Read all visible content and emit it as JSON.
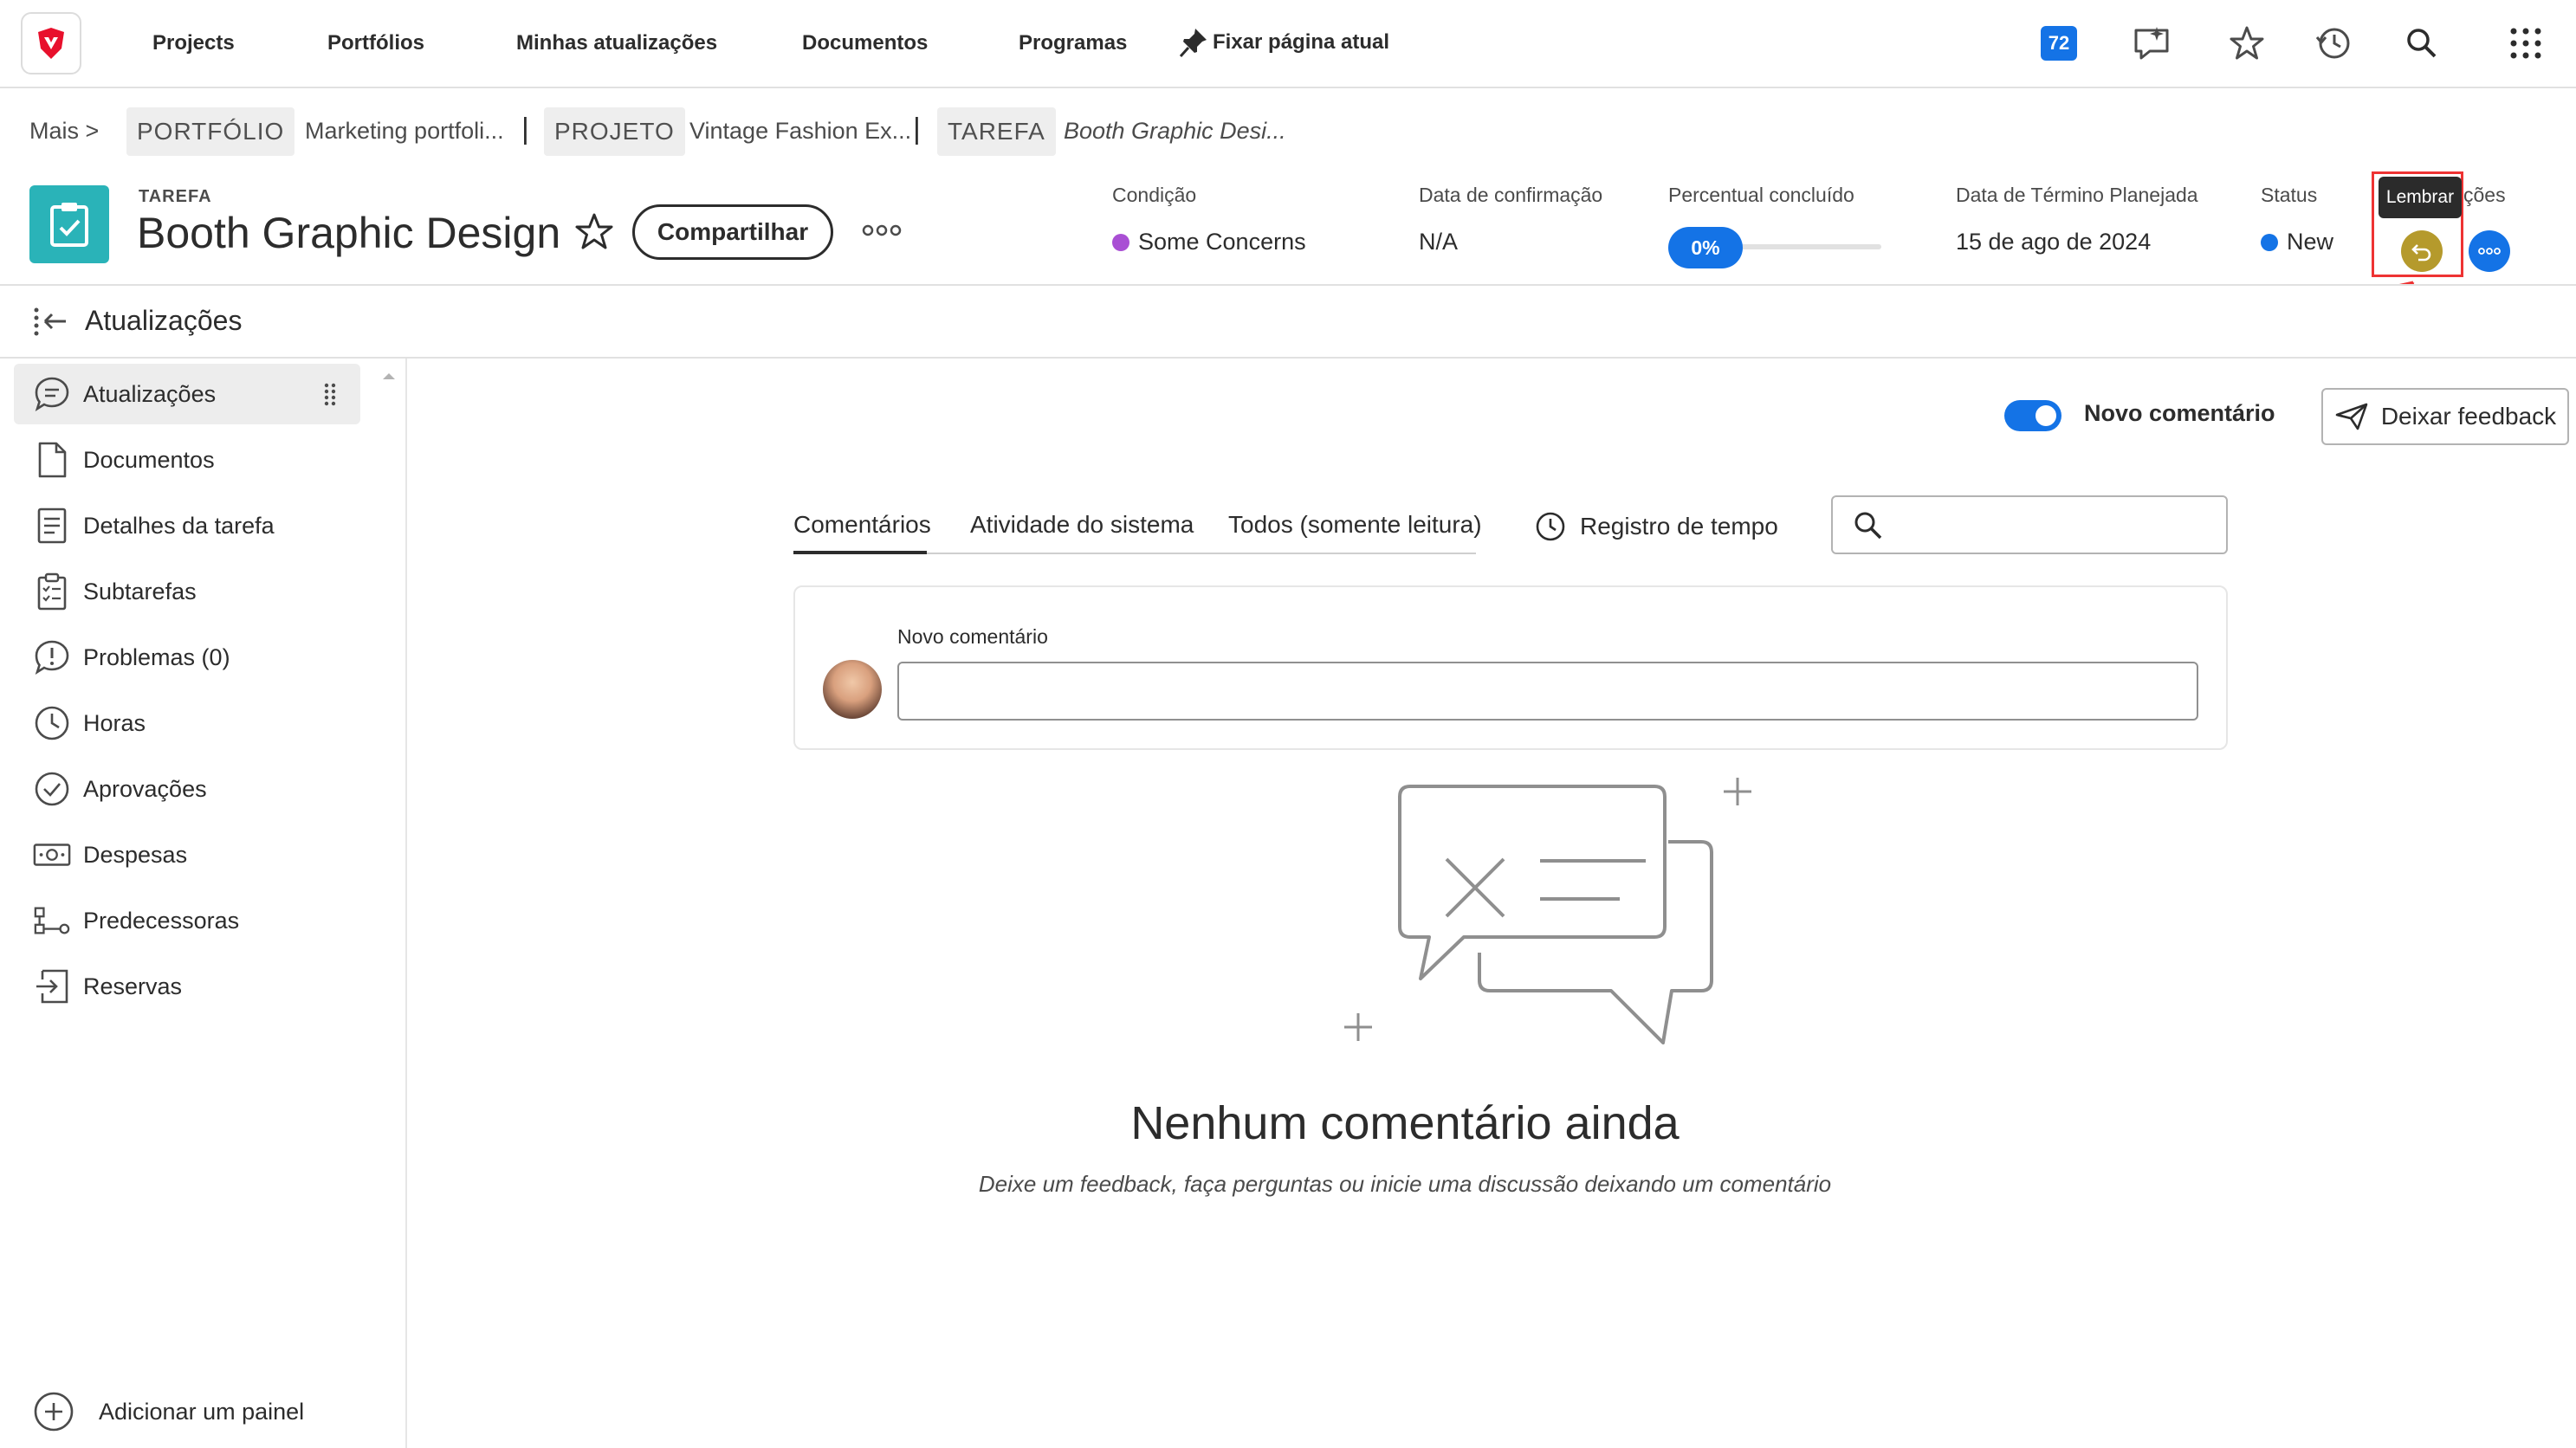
{
  "nav": {
    "links": [
      "Projects",
      "Portfólios",
      "Minhas atualizações",
      "Documentos",
      "Programas"
    ],
    "pin_label": "Fixar página atual",
    "notification_count": "72"
  },
  "breadcrumb": {
    "more": "Mais >",
    "portfolio_tag": "PORTFÓLIO",
    "portfolio_name": "Marketing portfoli...",
    "sep1": "|",
    "project_tag": "PROJETO",
    "project_name": "Vintage Fashion Ex...",
    "sep2": "|",
    "task_tag": "TAREFA",
    "task_name": "Booth Graphic Desi..."
  },
  "header": {
    "kicker": "TAREFA",
    "title": "Booth Graphic Design",
    "share_label": "Compartilhar",
    "condition_label": "Condição",
    "condition_value": "Some Concerns",
    "confirm_label": "Data de confirmação",
    "confirm_value": "N/A",
    "percent_label": "Percentual concluído",
    "percent_value": "0%",
    "planned_end_label": "Data de Término Planejada",
    "planned_end_value": "15 de ago de 2024",
    "status_label": "Status",
    "status_value": "New",
    "actions_label_partial": "ções",
    "tooltip": "Lembrar",
    "colors": {
      "condition": "#a94fd4",
      "status": "#1473e6",
      "accent": "#1473e6"
    }
  },
  "updates_bar": {
    "title": "Atualizações"
  },
  "sidebar": {
    "items": [
      {
        "label": "Atualizações",
        "icon": "chat-bubble-icon"
      },
      {
        "label": "Documentos",
        "icon": "document-icon"
      },
      {
        "label": "Detalhes da tarefa",
        "icon": "details-icon"
      },
      {
        "label": "Subtarefas",
        "icon": "subtasks-icon"
      },
      {
        "label": "Problemas (0)",
        "icon": "issue-icon"
      },
      {
        "label": "Horas",
        "icon": "clock-icon"
      },
      {
        "label": "Aprovações",
        "icon": "checkmark-circle-icon"
      },
      {
        "label": "Despesas",
        "icon": "money-icon"
      },
      {
        "label": "Predecessoras",
        "icon": "predecessor-icon"
      },
      {
        "label": "Reservas",
        "icon": "reservation-icon"
      }
    ],
    "add_panel": "Adicionar um painel"
  },
  "main": {
    "toggle_label": "Novo comentário",
    "feedback_label": "Deixar feedback",
    "tabs": [
      "Comentários",
      "Atividade do sistema",
      "Todos (somente leitura)"
    ],
    "time_log": "Registro de tempo",
    "comment_label": "Novo comentário",
    "empty_title": "Nenhum comentário ainda",
    "empty_subtitle": "Deixe um feedback, faça perguntas ou inicie uma discussão deixando um comentário"
  }
}
